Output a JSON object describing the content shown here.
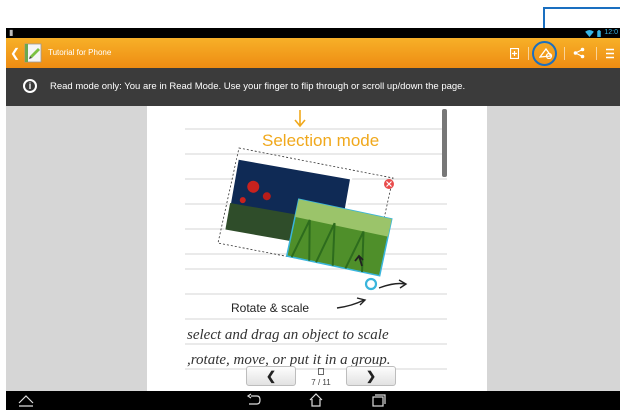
{
  "status_bar": {
    "time": "12:0",
    "wifi_icon": "wifi-icon",
    "battery_icon": "battery-icon",
    "notification_icon": "notification-icon"
  },
  "app": {
    "title": "Tutorial for Phone",
    "back_icon": "back-chevron-icon",
    "icon": "notebook-app-icon"
  },
  "toolbar": {
    "icons": [
      "bookmark-icon",
      "edit-mode-icon",
      "share-icon",
      "overflow-menu-icon"
    ]
  },
  "info_bar": {
    "text": "Read mode only: You are in Read Mode. Use your finger to flip through or scroll up/down the page."
  },
  "page_content": {
    "heading": "Selection mode",
    "caption": "Rotate & scale",
    "line1": "select and drag an object to scale",
    "line2": ",rotate, move, or put it in a group."
  },
  "pager": {
    "prev": "❮",
    "next": "❯",
    "current": "7",
    "total": "11",
    "separator": "/"
  },
  "nav_bar": {
    "icons": [
      "hide-nav-icon",
      "back-icon",
      "home-icon",
      "recent-apps-icon"
    ]
  },
  "colors": {
    "action_bar": "#f2a01e",
    "info_bar": "#3b3b3b",
    "accent_yellow": "#f0a81c",
    "callout_blue": "#1a6fc0",
    "selection_cyan": "#39b5dc"
  }
}
